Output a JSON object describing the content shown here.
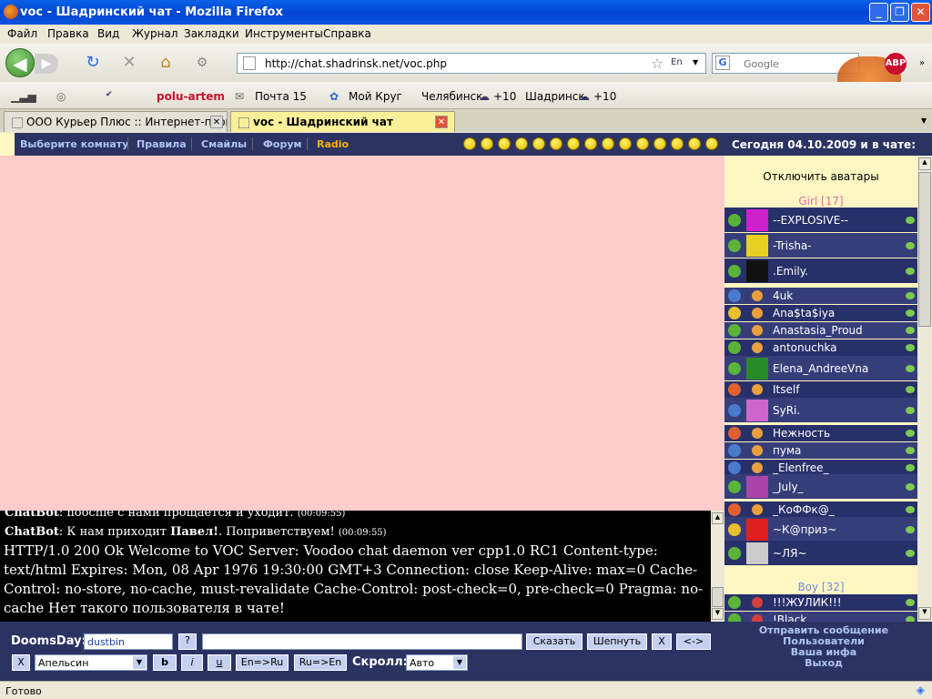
{
  "window": {
    "title": "voc - Шадринский чат - Mozilla Firefox"
  },
  "menu": [
    "Файл",
    "Правка",
    "Вид",
    "Журнал",
    "Закладки",
    "Инструменты",
    "Справка"
  ],
  "nav": {
    "url": "http://chat.shadrinsk.net/voc.php",
    "search_placeholder": "Google",
    "abp": "ABP"
  },
  "toolbar": {
    "user": "polu-artem",
    "mail": "Почта 15",
    "circle": "Мой Круг",
    "city1": "Челябинск",
    "temp1": "+10",
    "city2": "Шадринск",
    "temp2": "+10"
  },
  "tabs": [
    {
      "label": "ООО Курьер Плюс :: Интернет-пров..."
    },
    {
      "label": "voc - Шадринский чат"
    }
  ],
  "chatnav": {
    "links": [
      "Выберите комнату",
      "Правила",
      "Смайлы",
      "Форум",
      "Radio"
    ],
    "date": "Сегодня 04.10.2009 и в чате:"
  },
  "messages": [
    {
      "nick": "ChatBot",
      "text": ": hoochie с нами прощается и уходит.",
      "time": "(00:09:55)"
    },
    {
      "nick": "ChatBot",
      "text": ": К нам приходит ",
      "bold": "Павел!",
      "rest": ". Поприветствуем!",
      "time": "(00:09:55)"
    },
    {
      "big": "HTTP/1.0 200 Ok Welcome to VOC Server: Voodoo chat daemon ver cpp1.0 RC1 Content-type: text/html Expires: Mon, 08 Apr 1976 19:30:00 GMT+3 Connection: close Keep-Alive: max=0 Cache-Control: no-store, no-cache, must-revalidate Cache-Control: post-check=0, pre-check=0 Pragma: no-cache Нет такого пользователя в чате!"
    }
  ],
  "userpanel": {
    "toggle": "Отключить аватары",
    "girl_header": "Girl [17]",
    "boy_header": "Boy [32]",
    "girls": [
      "--EXPLOSIVE--",
      "-Trisha-",
      ".Emily.",
      "4uk",
      "Ana$ta$iya",
      "Anastasia_Proud",
      "antonuchka",
      "Elena_AndreeVna",
      "Itself",
      "SyRi.",
      "Нежность",
      "пума",
      "_Elenfree_",
      "_July_",
      "_КоФФк@_",
      "~К@приз~",
      "~ЛЯ~"
    ],
    "boys": [
      "!!!ЖУЛИК!!!",
      "!Black"
    ]
  },
  "bottom": {
    "nick_label": "DoomsDay:",
    "nick_value": "dustbin",
    "help": "?",
    "say": "Сказать",
    "whisper": "Шепнуть",
    "x": "X",
    "arrows": "<->",
    "x2": "X",
    "color": "Апельсин",
    "b": "b",
    "i": "i",
    "u": "u",
    "enru": "En=>Ru",
    "ruen": "Ru=>En",
    "scroll_label": "Скролл:",
    "scroll_value": "Авто",
    "links": [
      "Отправить сообщение",
      "Пользователи",
      "Ваша инфа",
      "Выход"
    ]
  },
  "status": "Готово"
}
